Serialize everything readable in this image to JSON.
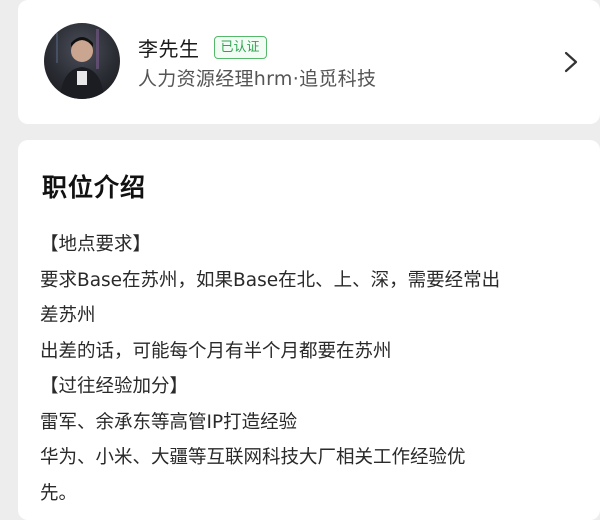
{
  "profile": {
    "name": "李先生",
    "badge": "已认证",
    "title": "人力资源经理hrm·追觅科技",
    "avatar_icon": "avatar-photo",
    "chevron_icon": "chevron-right-icon"
  },
  "job_description": {
    "heading": "职位介绍",
    "lines": [
      "【地点要求】",
      "要求Base在苏州，如果Base在北、上、深，需要经常出",
      "差苏州",
      "出差的话，可能每个月有半个月都要在苏州",
      "【过往经验加分】",
      "雷军、余承东等高管IP打造经验",
      "华为、小米、大疆等互联网科技大厂相关工作经验优",
      "先。"
    ]
  },
  "colors": {
    "badge_green": "#2ea44f",
    "page_background": "#ededed"
  }
}
